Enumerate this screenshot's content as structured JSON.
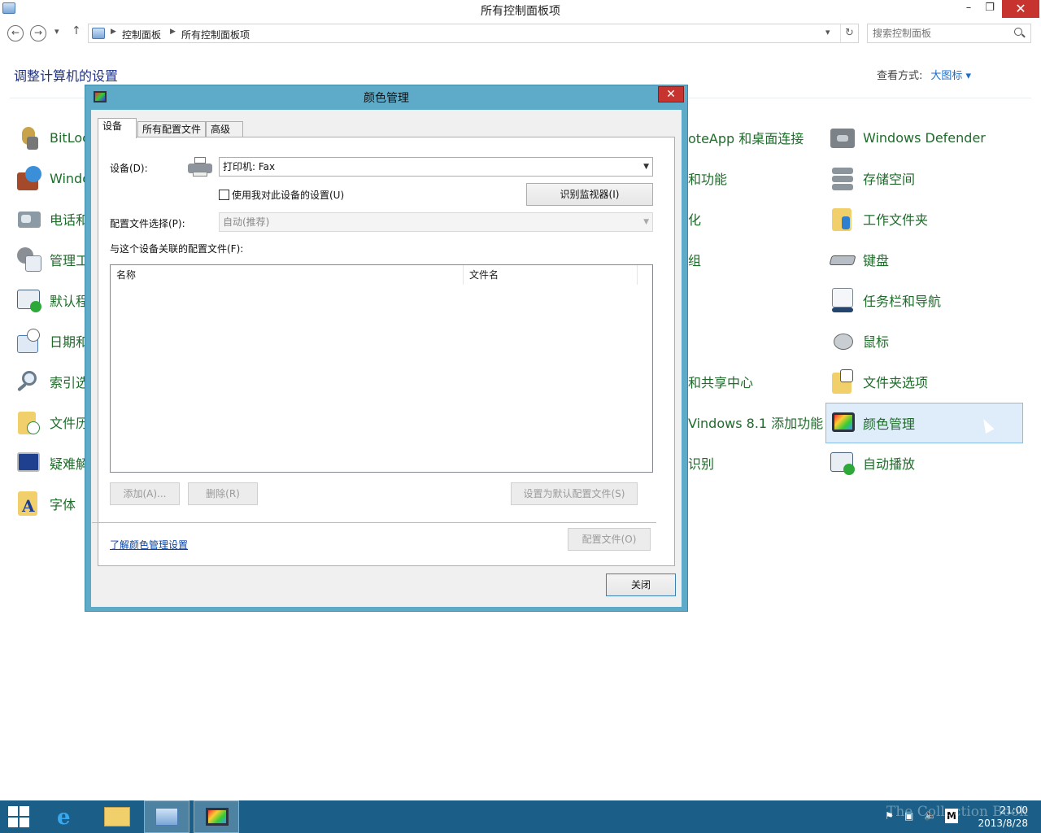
{
  "window": {
    "title": "所有控制面板项"
  },
  "address": {
    "crumbs": [
      "控制面板",
      "所有控制面板项"
    ],
    "search_placeholder": "搜索控制面板"
  },
  "header": {
    "title": "调整计算机的设置",
    "view_by_label": "查看方式:",
    "view_by_value": "大图标 ▾"
  },
  "items": {
    "left": [
      "BitLoc",
      "Windo",
      "电话和",
      "管理工",
      "默认程",
      "日期和",
      "索引选",
      "文件历",
      "疑难解",
      "字体"
    ],
    "middle": [
      "oteApp 和桌面连接",
      "和功能",
      "化",
      "组",
      "和共享中心",
      "Vindows 8.1 添加功能",
      "识别"
    ],
    "right": [
      "Windows Defender",
      "存储空间",
      "工作文件夹",
      "键盘",
      "任务栏和导航",
      "鼠标",
      "文件夹选项",
      "颜色管理",
      "自动播放"
    ]
  },
  "dialog": {
    "title": "颜色管理",
    "tabs": [
      "设备",
      "所有配置文件",
      "高级"
    ],
    "device_label": "设备(D):",
    "device_value": "打印机: Fax",
    "use_settings_label": "使用我对此设备的设置(U)",
    "identify_monitors": "识别监视器(I)",
    "profile_selection_label": "配置文件选择(P):",
    "profile_selection_value": "自动(推荐)",
    "associated_label": "与这个设备关联的配置文件(F):",
    "columns": [
      "名称",
      "文件名"
    ],
    "add": "添加(A)...",
    "remove": "删除(R)",
    "set_default": "设置为默认配置文件(S)",
    "profiles": "配置文件(O)",
    "learn_link": "了解颜色管理设置",
    "close": "关闭"
  },
  "taskbar": {
    "time": "21:00",
    "date": "2013/8/28",
    "watermark": "The Collection Book"
  }
}
